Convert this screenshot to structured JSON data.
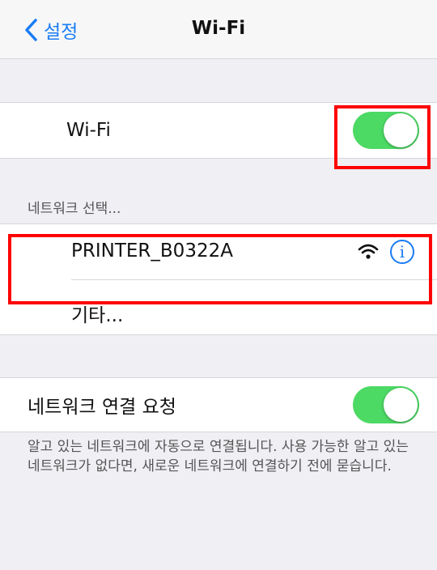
{
  "navbar": {
    "back_label": "설정",
    "title": "Wi-Fi"
  },
  "wifi_section": {
    "label": "Wi-Fi",
    "toggle_on": true
  },
  "networks_section": {
    "header": "네트워크 선택...",
    "networks": [
      {
        "name": "PRINTER_B0322A",
        "signal_icon": "wifi-icon",
        "info_icon": "info-icon"
      }
    ],
    "other_label": "기타..."
  },
  "ask_join": {
    "label": "네트워크 연결 요청",
    "toggle_on": true,
    "footer": "알고 있는 네트워크에 자동으로 연결됩니다. 사용 가능한 알고 있는 네트워크가 없다면, 새로운 네트워크에 연결하기 전에 묻습니다."
  },
  "colors": {
    "accent": "#1a7cf5",
    "toggle_on": "#4cd964",
    "highlight": "#ff0000",
    "background": "#efeff4"
  }
}
